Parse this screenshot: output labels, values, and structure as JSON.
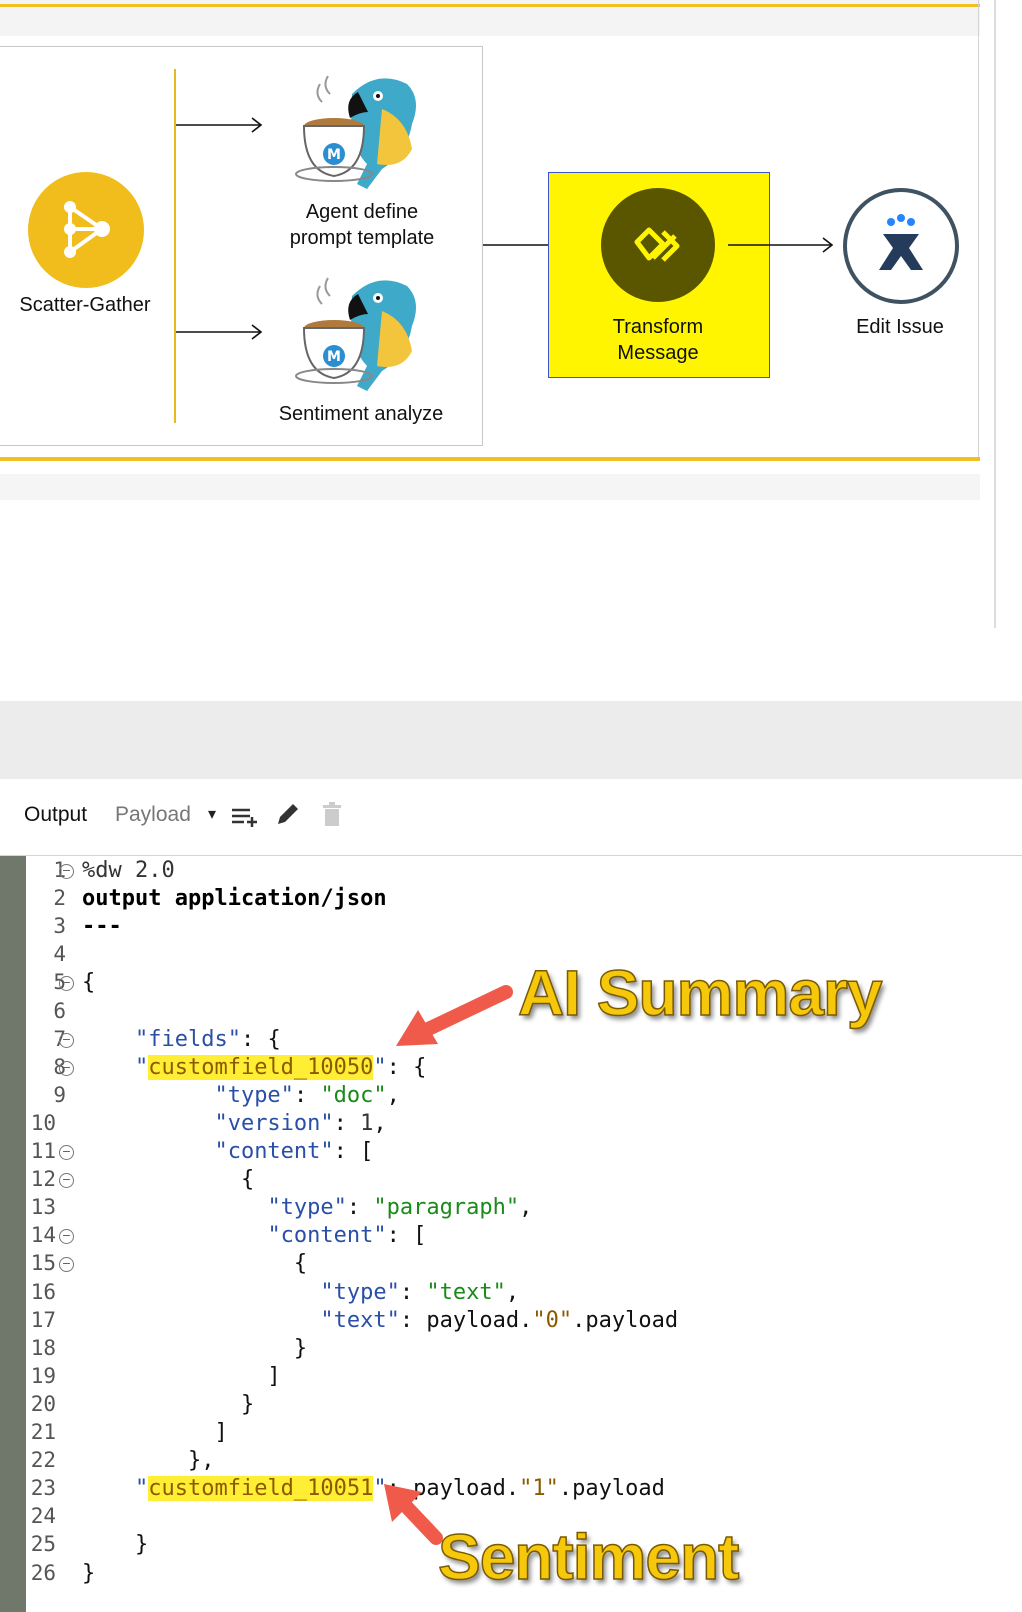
{
  "flow": {
    "scatter_gather": {
      "label": "Scatter-Gather"
    },
    "agent_define": {
      "label": "Agent define\nprompt template"
    },
    "sentiment": {
      "label": "Sentiment analyze"
    },
    "transform": {
      "label": "Transform\nMessage"
    },
    "edit_issue": {
      "label": "Edit Issue"
    }
  },
  "toolbar": {
    "output_label": "Output",
    "payload_label": "Payload",
    "icons": [
      "add-mapping-icon",
      "edit-icon",
      "delete-icon"
    ]
  },
  "code": {
    "line_numbers": [
      "1",
      "2",
      "3",
      "4",
      "5",
      "6",
      "7",
      "8",
      "9",
      "10",
      "11",
      "12",
      "13",
      "14",
      "15",
      "16",
      "17",
      "18",
      "19",
      "20",
      "21",
      "22",
      "23",
      "24",
      "25",
      "26"
    ],
    "lines": [
      "%dw 2.0",
      "output application/json",
      "---",
      "",
      "{",
      "",
      "    \"fields\": {",
      "    \"customfield_10050\": {",
      "          \"type\": \"doc\",",
      "          \"version\": 1,",
      "          \"content\": [",
      "            {",
      "              \"type\": \"paragraph\",",
      "              \"content\": [",
      "                {",
      "                  \"type\": \"text\",",
      "                  \"text\": payload.\"0\".payload",
      "                }",
      "              ]",
      "            }",
      "          ]",
      "        },",
      "    \"customfield_10051\": payload.\"1\".payload",
      "",
      "    }",
      "}"
    ]
  },
  "annotations": {
    "ai_summary": "AI Summary",
    "sentiment": "Sentiment"
  },
  "colors": {
    "accent_gold": "#f0bd1c",
    "transform_bg": "#fff500",
    "highlight": "#ffee33",
    "callout": "#f5c80c",
    "arrow": "#ef5a4a"
  }
}
